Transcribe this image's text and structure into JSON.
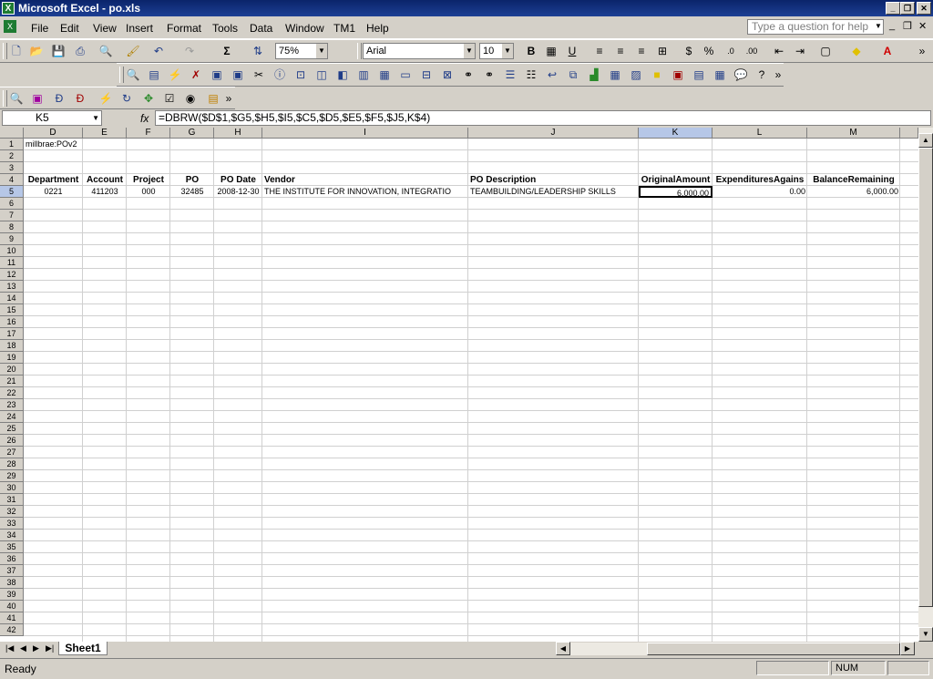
{
  "window": {
    "title": "Microsoft Excel - po.xls",
    "icon": "excel-icon"
  },
  "menu": {
    "items": [
      "File",
      "Edit",
      "View",
      "Insert",
      "Format",
      "Tools",
      "Data",
      "Window",
      "TM1",
      "Help"
    ],
    "help_placeholder": "Type a question for help"
  },
  "toolbar": {
    "zoom": "75%",
    "font": "Arial",
    "font_size": "10"
  },
  "formula_bar": {
    "name_box": "K5",
    "fx": "fx",
    "formula": "=DBRW($D$1,$G5,$H5,$I5,$C5,$D5,$E5,$F5,$J5,K$4)"
  },
  "sheet": {
    "columns": [
      "D",
      "E",
      "F",
      "G",
      "H",
      "I",
      "J",
      "K",
      "L",
      "M",
      ""
    ],
    "rows": [
      "1",
      "2",
      "3",
      "4",
      "5",
      "6",
      "7",
      "8",
      "9",
      "10",
      "11",
      "12",
      "13",
      "14",
      "15",
      "16",
      "17",
      "18",
      "19",
      "20",
      "21",
      "22",
      "23",
      "24",
      "25",
      "26",
      "27",
      "28",
      "29",
      "30",
      "31",
      "32",
      "33",
      "34",
      "35",
      "36",
      "37",
      "38",
      "39",
      "40",
      "41",
      "42"
    ],
    "selected_cell": "K5",
    "cell_d1": "millbrae:POv2",
    "headers": [
      "Department",
      "Account",
      "Project",
      "PO",
      "PO Date",
      "Vendor",
      "PO Description",
      "OriginalAmount",
      "ExpendituresAgains",
      "BalanceRemaining"
    ],
    "row5": [
      "0221",
      "411203",
      "000",
      "32485",
      "2008-12-30",
      "THE INSTITUTE FOR INNOVATION, INTEGRATIO",
      "TEAMBUILDING/LEADERSHIP SKILLS",
      "6,000.00",
      "0.00",
      "6,000.00"
    ]
  },
  "tabs": {
    "sheets": [
      "Sheet1"
    ]
  },
  "status": {
    "text": "Ready",
    "num": "NUM"
  }
}
